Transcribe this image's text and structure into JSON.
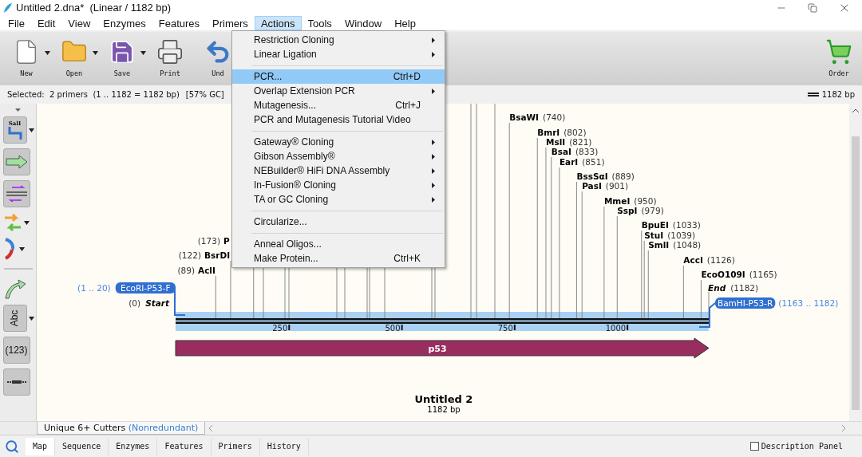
{
  "window": {
    "title": "Untitled 2.dna*  (Linear / 1182 bp)"
  },
  "menu_bar": [
    {
      "label": "File",
      "selected": false
    },
    {
      "label": "Edit",
      "selected": false
    },
    {
      "label": "View",
      "selected": false
    },
    {
      "label": "Enzymes",
      "selected": false
    },
    {
      "label": "Features",
      "selected": false
    },
    {
      "label": "Primers",
      "selected": false
    },
    {
      "label": "Actions",
      "selected": true
    },
    {
      "label": "Tools",
      "selected": false
    },
    {
      "label": "Window",
      "selected": false
    },
    {
      "label": "Help",
      "selected": false
    }
  ],
  "toolbar": [
    {
      "kind": "new",
      "label": "New",
      "dropdown": true
    },
    {
      "kind": "open",
      "label": "Open",
      "dropdown": true
    },
    {
      "kind": "save",
      "label": "Save",
      "dropdown": true
    },
    {
      "kind": "print",
      "label": "Print",
      "dropdown": false
    },
    {
      "kind": "undo",
      "label": "Und",
      "dropdown": false
    }
  ],
  "order_button": {
    "label": "Order"
  },
  "selection_bar": {
    "text": "Selected:  2 primers  (1 .. 1182 = 1182 bp)",
    "gc": "[57% GC]",
    "length": "1182 bp"
  },
  "actions_menu": [
    {
      "kind": "item",
      "label": "Restriction Cloning",
      "submenu": true,
      "selected": false
    },
    {
      "kind": "item",
      "label": "Linear Ligation",
      "submenu": true,
      "selected": false
    },
    {
      "kind": "separator"
    },
    {
      "kind": "item",
      "label": "PCR...",
      "shortcut": "Ctrl+D",
      "submenu": false,
      "selected": true
    },
    {
      "kind": "item",
      "label": "Overlap Extension PCR",
      "submenu": true,
      "selected": false
    },
    {
      "kind": "item",
      "label": "Mutagenesis...",
      "shortcut": "Ctrl+J",
      "submenu": false,
      "selected": false
    },
    {
      "kind": "item",
      "label": "PCR and Mutagenesis Tutorial Video",
      "submenu": false,
      "selected": false
    },
    {
      "kind": "separator"
    },
    {
      "kind": "item",
      "label": "Gateway® Cloning",
      "submenu": true,
      "selected": false
    },
    {
      "kind": "item",
      "label": "Gibson Assembly®",
      "submenu": true,
      "selected": false
    },
    {
      "kind": "item",
      "label": "NEBuilder® HiFi DNA Assembly",
      "submenu": true,
      "selected": false
    },
    {
      "kind": "item",
      "label": "In-Fusion® Cloning",
      "submenu": true,
      "selected": false
    },
    {
      "kind": "item",
      "label": "TA or GC Cloning",
      "submenu": true,
      "selected": false
    },
    {
      "kind": "separator"
    },
    {
      "kind": "item",
      "label": "Circularize...",
      "submenu": false,
      "selected": false
    },
    {
      "kind": "separator"
    },
    {
      "kind": "item",
      "label": "Anneal Oligos...",
      "submenu": false,
      "selected": false
    },
    {
      "kind": "item",
      "label": "Make Protein...",
      "shortcut": "Ctrl+K",
      "submenu": false,
      "selected": false
    }
  ],
  "side_tools": [
    {
      "kind": "enzyme",
      "label": "SalI",
      "dropdown": true
    },
    {
      "kind": "feature",
      "dropdown": false
    },
    {
      "kind": "primer",
      "dropdown": false
    },
    {
      "kind": "orf",
      "dropdown": true
    },
    {
      "kind": "arc",
      "dropdown": true
    },
    {
      "kind": "separator"
    },
    {
      "kind": "curve",
      "dropdown": false
    },
    {
      "kind": "text",
      "label": "Abc",
      "dropdown": true
    },
    {
      "kind": "numbers",
      "label": "(123)",
      "dropdown": false
    },
    {
      "kind": "line",
      "dropdown": false
    }
  ],
  "map": {
    "sites_left": [
      {
        "name": "P",
        "position": "(173)"
      },
      {
        "name": "BsrDI",
        "position": "(122)"
      },
      {
        "name": "AclI",
        "position": "(89)"
      }
    ],
    "sites_right": [
      {
        "name": "BsaWI",
        "position": "(740)"
      },
      {
        "name": "BmrI",
        "position": "(802)"
      },
      {
        "name": "MslI",
        "position": "(821)"
      },
      {
        "name": "BsaI",
        "position": "(833)"
      },
      {
        "name": "EarI",
        "position": "(851)"
      },
      {
        "name": "BssSαI",
        "position": "(889)"
      },
      {
        "name": "PasI",
        "position": "(901)"
      },
      {
        "name": "MmeI",
        "position": "(950)"
      },
      {
        "name": "SspI",
        "position": "(979)"
      },
      {
        "name": "BpuEI",
        "position": "(1033)"
      },
      {
        "name": "StuI",
        "position": "(1039)"
      },
      {
        "name": "SmlI",
        "position": "(1048)"
      },
      {
        "name": "AccI",
        "position": "(1126)"
      },
      {
        "name": "EcoO109I",
        "position": "(1165)"
      }
    ],
    "start": {
      "name": "Start",
      "position": "(0)"
    },
    "end": {
      "name": "End",
      "position": "(1182)"
    },
    "ticks": [
      "250",
      "500",
      "750",
      "1000"
    ],
    "feature": {
      "name": "p53"
    },
    "forward_primers": [
      {
        "name": "EcoRI-P53-F",
        "range": "(1 .. 20)"
      }
    ],
    "reverse_primers": [
      {
        "name": "BamHI-P53-R",
        "range": "(1163 .. 1182)"
      }
    ],
    "title": "Untitled 2",
    "length": "1182 bp"
  },
  "view_tab": {
    "label": "Unique 6+ Cutters",
    "mode": "(Nonredundant)"
  },
  "bottom_tabs": [
    {
      "label": "Map",
      "selected": true
    },
    {
      "label": "Sequence",
      "selected": false
    },
    {
      "label": "Enzymes",
      "selected": false
    },
    {
      "label": "Features",
      "selected": false
    },
    {
      "label": "Primers",
      "selected": false
    },
    {
      "label": "History",
      "selected": false
    }
  ],
  "description_panel": {
    "label": "Description Panel",
    "checked": false
  }
}
